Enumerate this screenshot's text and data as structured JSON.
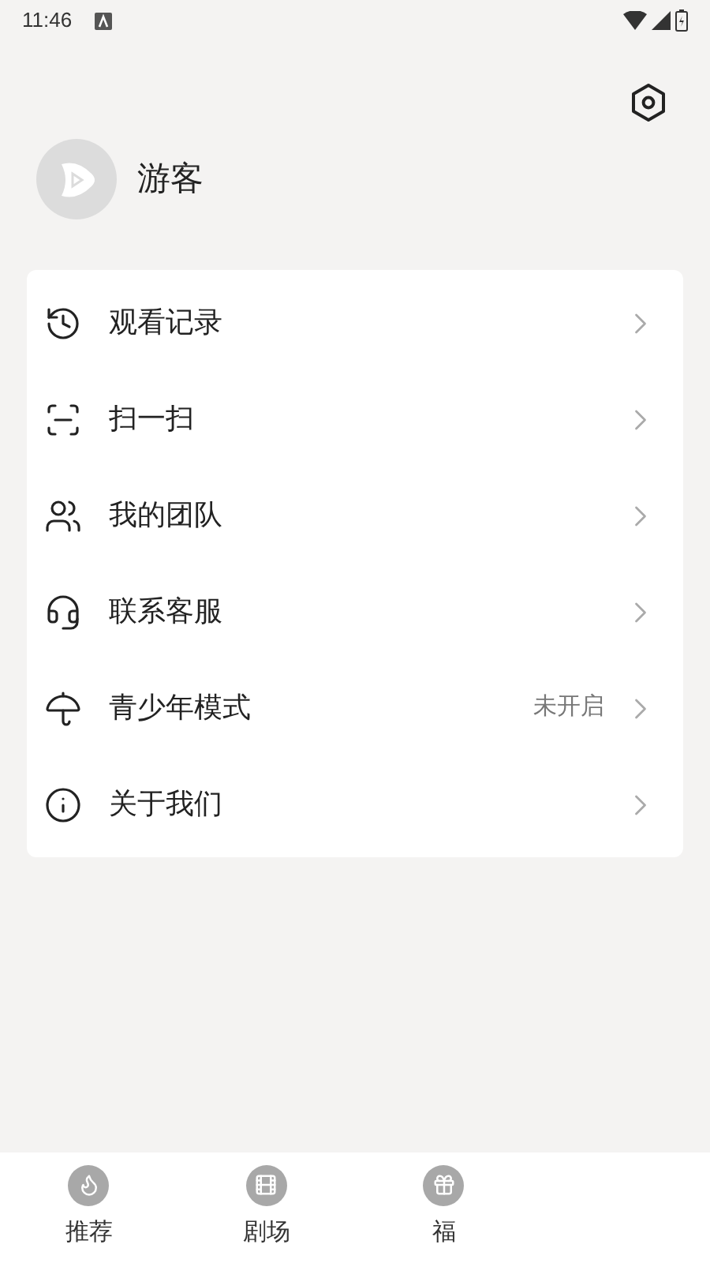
{
  "status_bar": {
    "time": "11:46"
  },
  "profile": {
    "name": "游客"
  },
  "menu": [
    {
      "label": "观看记录",
      "kind": "history"
    },
    {
      "label": "扫一扫",
      "kind": "scan"
    },
    {
      "label": "我的团队",
      "kind": "team"
    },
    {
      "label": "联系客服",
      "kind": "service"
    },
    {
      "label": "青少年模式",
      "kind": "youth",
      "status": "未开启"
    },
    {
      "label": "关于我们",
      "kind": "about"
    }
  ],
  "bottom_nav": [
    {
      "label": "推荐",
      "kind": "flame",
      "selected": false
    },
    {
      "label": "剧场",
      "kind": "reel",
      "selected": false
    },
    {
      "label": "福",
      "kind": "gift",
      "selected": false
    }
  ]
}
